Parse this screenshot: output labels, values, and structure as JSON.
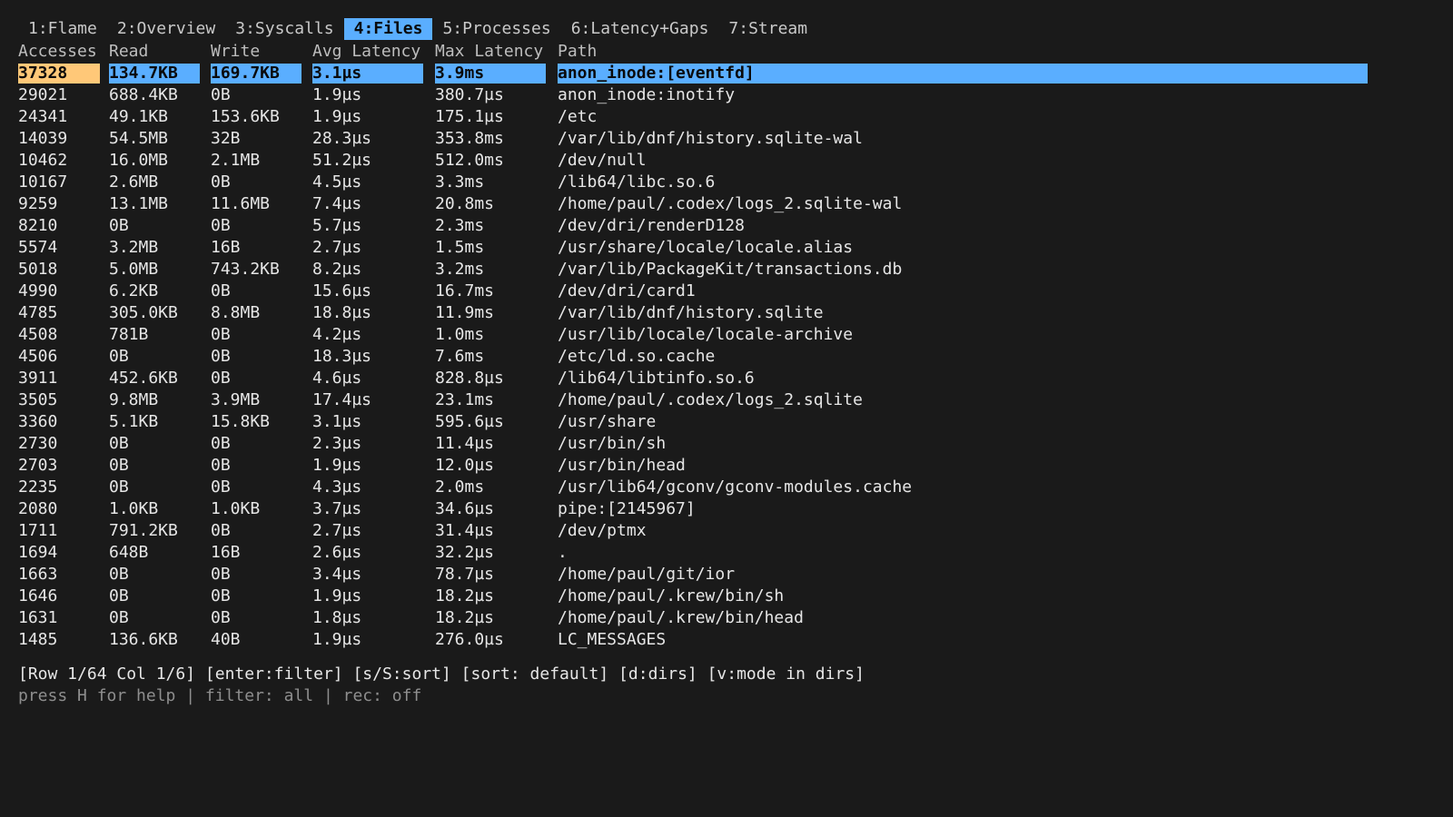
{
  "tabs": [
    {
      "label": "1:Flame",
      "active": false
    },
    {
      "label": "2:Overview",
      "active": false
    },
    {
      "label": "3:Syscalls",
      "active": false
    },
    {
      "label": "4:Files",
      "active": true
    },
    {
      "label": "5:Processes",
      "active": false
    },
    {
      "label": "6:Latency+Gaps",
      "active": false
    },
    {
      "label": "7:Stream",
      "active": false
    }
  ],
  "table": {
    "columns": [
      "Accesses",
      "Read",
      "Write",
      "Avg Latency",
      "Max Latency",
      "Path"
    ],
    "selected_row": 0,
    "rows": [
      [
        "37328",
        "134.7KB",
        "169.7KB",
        "3.1µs",
        "3.9ms",
        "anon_inode:[eventfd]"
      ],
      [
        "29021",
        "688.4KB",
        "0B",
        "1.9µs",
        "380.7µs",
        "anon_inode:inotify"
      ],
      [
        "24341",
        "49.1KB",
        "153.6KB",
        "1.9µs",
        "175.1µs",
        "/etc"
      ],
      [
        "14039",
        "54.5MB",
        "32B",
        "28.3µs",
        "353.8ms",
        "/var/lib/dnf/history.sqlite-wal"
      ],
      [
        "10462",
        "16.0MB",
        "2.1MB",
        "51.2µs",
        "512.0ms",
        "/dev/null"
      ],
      [
        "10167",
        "2.6MB",
        "0B",
        "4.5µs",
        "3.3ms",
        "/lib64/libc.so.6"
      ],
      [
        "9259",
        "13.1MB",
        "11.6MB",
        "7.4µs",
        "20.8ms",
        "/home/paul/.codex/logs_2.sqlite-wal"
      ],
      [
        "8210",
        "0B",
        "0B",
        "5.7µs",
        "2.3ms",
        "/dev/dri/renderD128"
      ],
      [
        "5574",
        "3.2MB",
        "16B",
        "2.7µs",
        "1.5ms",
        "/usr/share/locale/locale.alias"
      ],
      [
        "5018",
        "5.0MB",
        "743.2KB",
        "8.2µs",
        "3.2ms",
        "/var/lib/PackageKit/transactions.db"
      ],
      [
        "4990",
        "6.2KB",
        "0B",
        "15.6µs",
        "16.7ms",
        "/dev/dri/card1"
      ],
      [
        "4785",
        "305.0KB",
        "8.8MB",
        "18.8µs",
        "11.9ms",
        "/var/lib/dnf/history.sqlite"
      ],
      [
        "4508",
        "781B",
        "0B",
        "4.2µs",
        "1.0ms",
        "/usr/lib/locale/locale-archive"
      ],
      [
        "4506",
        "0B",
        "0B",
        "18.3µs",
        "7.6ms",
        "/etc/ld.so.cache"
      ],
      [
        "3911",
        "452.6KB",
        "0B",
        "4.6µs",
        "828.8µs",
        "/lib64/libtinfo.so.6"
      ],
      [
        "3505",
        "9.8MB",
        "3.9MB",
        "17.4µs",
        "23.1ms",
        "/home/paul/.codex/logs_2.sqlite"
      ],
      [
        "3360",
        "5.1KB",
        "15.8KB",
        "3.1µs",
        "595.6µs",
        "/usr/share"
      ],
      [
        "2730",
        "0B",
        "0B",
        "2.3µs",
        "11.4µs",
        "/usr/bin/sh"
      ],
      [
        "2703",
        "0B",
        "0B",
        "1.9µs",
        "12.0µs",
        "/usr/bin/head"
      ],
      [
        "2235",
        "0B",
        "0B",
        "4.3µs",
        "2.0ms",
        "/usr/lib64/gconv/gconv-modules.cache"
      ],
      [
        "2080",
        "1.0KB",
        "1.0KB",
        "3.7µs",
        "34.6µs",
        "pipe:[2145967]"
      ],
      [
        "1711",
        "791.2KB",
        "0B",
        "2.7µs",
        "31.4µs",
        "/dev/ptmx"
      ],
      [
        "1694",
        "648B",
        "16B",
        "2.6µs",
        "32.2µs",
        "."
      ],
      [
        "1663",
        "0B",
        "0B",
        "3.4µs",
        "78.7µs",
        "/home/paul/git/ior"
      ],
      [
        "1646",
        "0B",
        "0B",
        "1.9µs",
        "18.2µs",
        "/home/paul/.krew/bin/sh"
      ],
      [
        "1631",
        "0B",
        "0B",
        "1.8µs",
        "18.2µs",
        "/home/paul/.krew/bin/head"
      ],
      [
        "1485",
        "136.6KB",
        "40B",
        "1.9µs",
        "276.0µs",
        "LC_MESSAGES"
      ]
    ]
  },
  "status_line": "[Row 1/64 Col 1/6] [enter:filter] [s/S:sort] [sort: default] [d:dirs] [v:mode in dirs]",
  "hint_line": "press H for help | filter: all | rec: off",
  "colors": {
    "background": "#1a1a1a",
    "selection": "#5aaeff",
    "selected_cell": "#ffc878",
    "text": "#e6e6e6",
    "dim_text": "#8e8e8e"
  }
}
